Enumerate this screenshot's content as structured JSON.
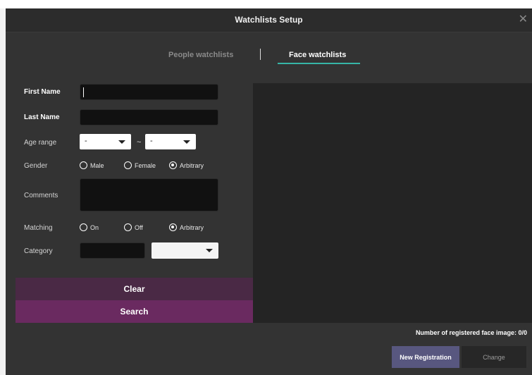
{
  "window": {
    "title": "Watchlists Setup",
    "close_symbol": "✕"
  },
  "tabs": [
    {
      "label": "People watchlists",
      "active": false
    },
    {
      "label": "Face watchlists",
      "active": true
    }
  ],
  "form": {
    "first_name": {
      "label": "First Name",
      "value": ""
    },
    "last_name": {
      "label": "Last Name",
      "value": ""
    },
    "age_range": {
      "label": "Age range",
      "from": "-",
      "separator": "~",
      "to": "-"
    },
    "gender": {
      "label": "Gender",
      "options": [
        "Male",
        "Female",
        "Arbitrary"
      ],
      "selected": "Arbitrary"
    },
    "comments": {
      "label": "Comments",
      "value": ""
    },
    "matching": {
      "label": "Matching",
      "options": [
        "On",
        "Off",
        "Arbitrary"
      ],
      "selected": "Arbitrary"
    },
    "category": {
      "label": "Category",
      "value": "",
      "select_value": ""
    }
  },
  "buttons": {
    "clear": "Clear",
    "search": "Search",
    "new_registration": "New Registration",
    "change": "Change"
  },
  "status": {
    "registered_count": "Number of registered face image: 0/0"
  },
  "colors": {
    "accent_tab": "#36b5a7",
    "clear_bg": "#4a2945",
    "search_bg": "#6a2a60",
    "new_reg_bg": "#58577f"
  }
}
